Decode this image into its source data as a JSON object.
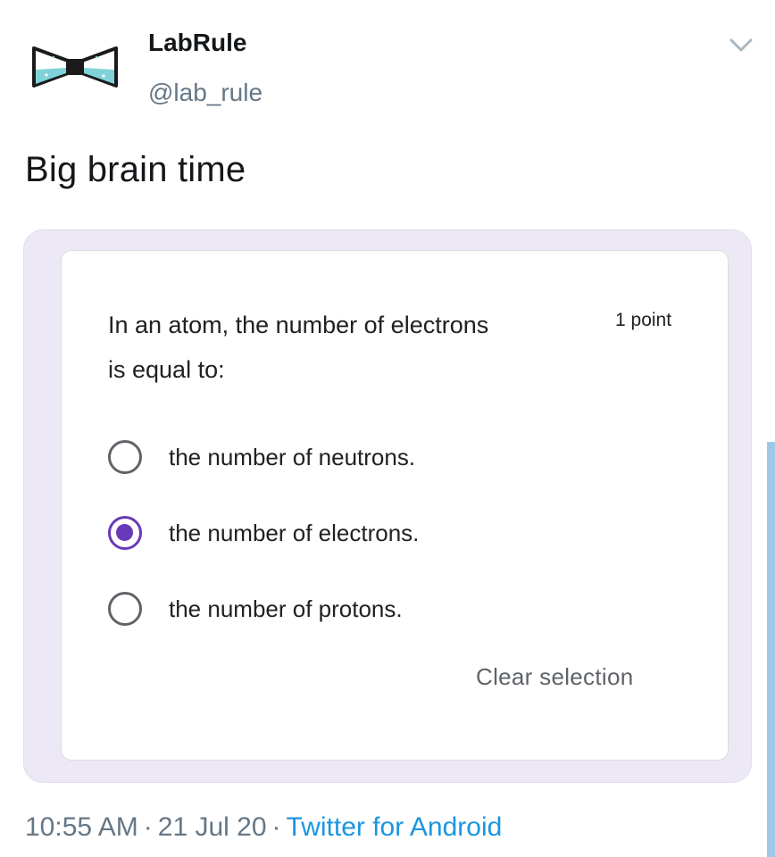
{
  "author": {
    "display_name": "LabRule",
    "handle": "@lab_rule",
    "avatar_icon": "bow-tie-flask-logo-icon"
  },
  "tweet": {
    "text": "Big brain time"
  },
  "form": {
    "question_line1": "In an atom, the number of electrons",
    "question_line2": "is equal to:",
    "points": "1 point",
    "options": [
      {
        "label": "the number of neutrons.",
        "selected": false
      },
      {
        "label": "the number of electrons.",
        "selected": true
      },
      {
        "label": "the number of protons.",
        "selected": false
      }
    ],
    "clear_selection": "Clear selection",
    "accent_color": "#673ab7"
  },
  "meta": {
    "time": "10:55 AM",
    "separator": "·",
    "date": "21 Jul 20",
    "source": "Twitter for Android",
    "source_color": "#1b95e0"
  }
}
